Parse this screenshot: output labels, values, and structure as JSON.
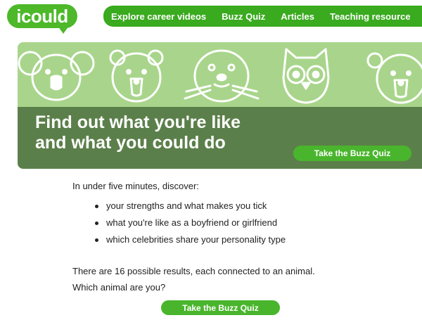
{
  "logo": {
    "text": "icould"
  },
  "nav": {
    "items": [
      {
        "label": "Explore career videos"
      },
      {
        "label": "Buzz Quiz"
      },
      {
        "label": "Articles"
      },
      {
        "label": "Teaching resource"
      }
    ]
  },
  "banner": {
    "headline_line1": "Find out what you're like",
    "headline_line2": "and what you could do",
    "quiz_button": "Take the Buzz Quiz",
    "animal_icons": [
      "koala-icon",
      "bear-icon",
      "seal-icon",
      "owl-icon",
      "polar-bear-icon"
    ],
    "colors": {
      "light": "#a8d58b",
      "dark": "#5b7f4a",
      "accent": "#49b52c"
    }
  },
  "content": {
    "intro": "In under five minutes, discover:",
    "bullets": [
      "your strengths and what makes you tick",
      "what you're like as a boyfriend or girlfriend",
      "which celebrities share your personality type"
    ],
    "results_line1": "There are 16 possible results, each connected to an animal.",
    "results_line2": "Which animal are you?",
    "quiz_button": "Take the Buzz Quiz"
  }
}
